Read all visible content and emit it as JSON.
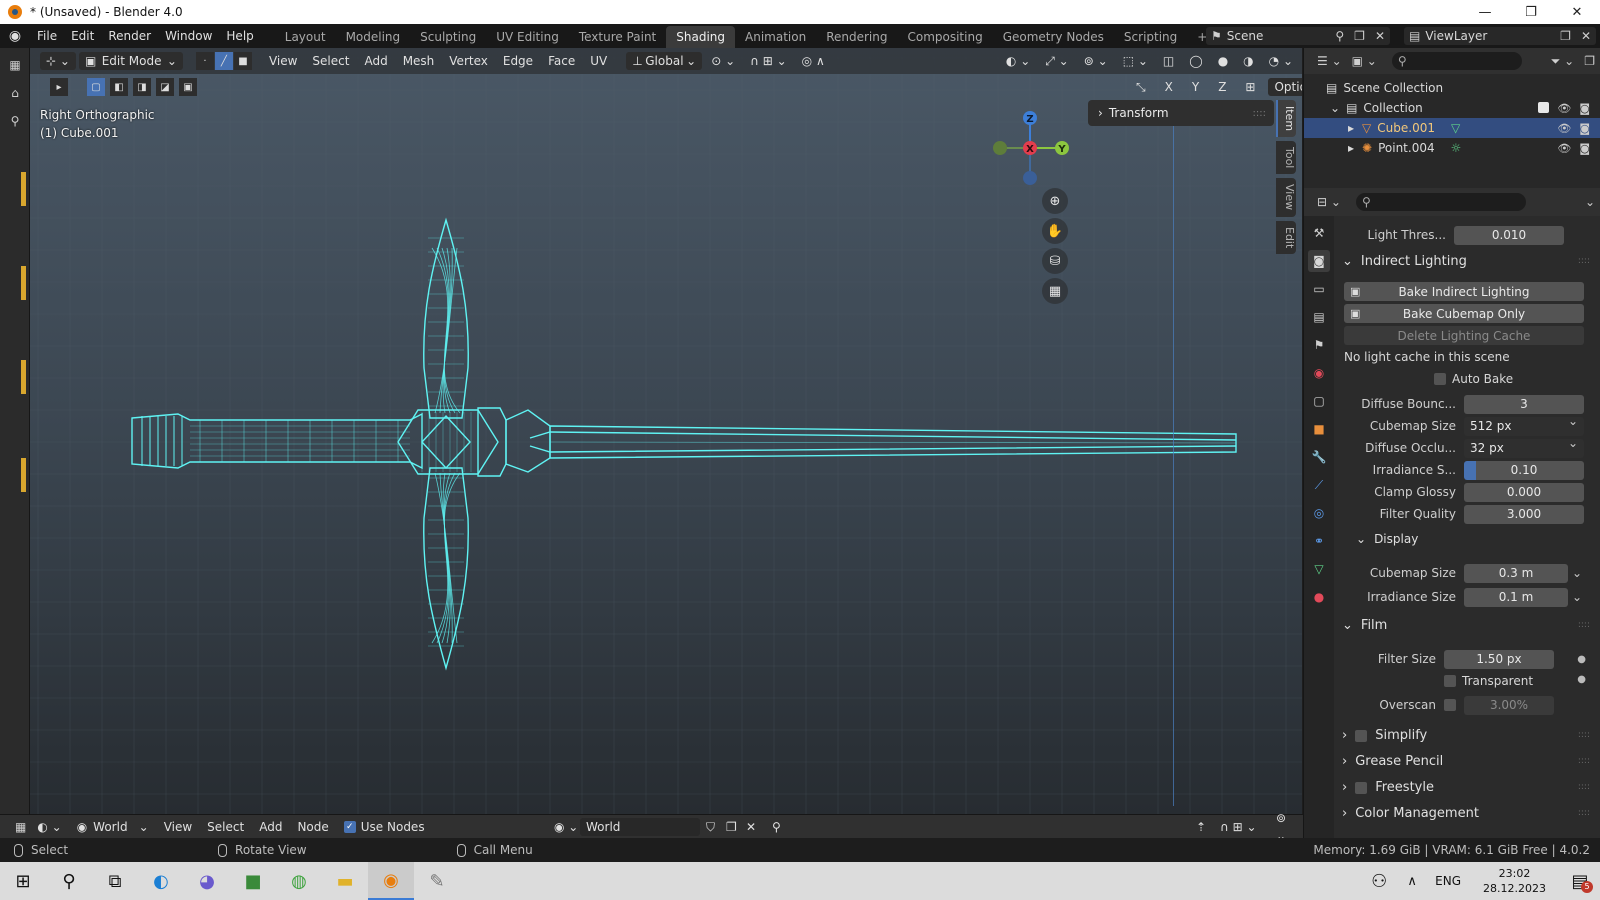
{
  "window": {
    "title": "* (Unsaved) - Blender 4.0",
    "controls": [
      "—",
      "❐",
      "✕"
    ]
  },
  "menus": [
    "File",
    "Edit",
    "Render",
    "Window",
    "Help"
  ],
  "workspace_tabs": [
    {
      "label": "Layout",
      "active": false
    },
    {
      "label": "Modeling",
      "active": false
    },
    {
      "label": "Sculpting",
      "active": false
    },
    {
      "label": "UV Editing",
      "active": false
    },
    {
      "label": "Texture Paint",
      "active": false
    },
    {
      "label": "Shading",
      "active": true
    },
    {
      "label": "Animation",
      "active": false
    },
    {
      "label": "Rendering",
      "active": false
    },
    {
      "label": "Compositing",
      "active": false
    },
    {
      "label": "Geometry Nodes",
      "active": false
    },
    {
      "label": "Scripting",
      "active": false
    }
  ],
  "add_workspace": "+",
  "scene": {
    "label": "Scene"
  },
  "view_layer": {
    "label": "ViewLayer"
  },
  "viewport": {
    "mode": "Edit Mode",
    "menus": [
      "View",
      "Select",
      "Add",
      "Mesh",
      "Vertex",
      "Edge",
      "Face",
      "UV"
    ],
    "transform_orientation": "Global",
    "view_name": "Right Orthographic",
    "object_name": "(1) Cube.001",
    "options_label": "Options",
    "axis_lock": [
      "X",
      "Y",
      "Z"
    ],
    "transform_panel": "Transform",
    "side_tabs": [
      "Item",
      "Tool",
      "View",
      "Edit"
    ],
    "gizmo": {
      "z": "Z",
      "x": "X",
      "y": "Y"
    },
    "colors": {
      "wire": "#5ff3f3",
      "accent": "#4772b3",
      "axis_x": "#e23d4d",
      "axis_y": "#8cc63f",
      "axis_z": "#3d7fd9"
    }
  },
  "outliner": {
    "root": "Scene Collection",
    "collection": "Collection",
    "items": [
      {
        "name": "Cube.001",
        "selected": true
      },
      {
        "name": "Point.004",
        "selected": false
      }
    ]
  },
  "properties": {
    "light_threshold": {
      "label": "Light Thres...",
      "value": "0.010"
    },
    "indirect_lighting": {
      "title": "Indirect Lighting",
      "bake_indirect": "Bake Indirect Lighting",
      "bake_cubemap": "Bake Cubemap Only",
      "delete_cache": "Delete Lighting Cache",
      "info": "No light cache in this scene",
      "auto_bake": "Auto Bake",
      "diffuse_bounces": {
        "label": "Diffuse Bounc...",
        "value": "3"
      },
      "cubemap_size": {
        "label": "Cubemap Size",
        "value": "512 px"
      },
      "diffuse_occlusion": {
        "label": "Diffuse Occlu...",
        "value": "32 px"
      },
      "irradiance_smoothing": {
        "label": "Irradiance S...",
        "value": "0.10",
        "fraction": 0.1
      },
      "clamp_glossy": {
        "label": "Clamp Glossy",
        "value": "0.000"
      },
      "filter_quality": {
        "label": "Filter Quality",
        "value": "3.000"
      }
    },
    "display": {
      "title": "Display",
      "cubemap_size": {
        "label": "Cubemap Size",
        "value": "0.3 m"
      },
      "irradiance_size": {
        "label": "Irradiance Size",
        "value": "0.1 m"
      }
    },
    "film": {
      "title": "Film",
      "filter_size": {
        "label": "Filter Size",
        "value": "1.50 px"
      },
      "transparent": "Transparent",
      "overscan": {
        "label": "Overscan",
        "value": "3.00%"
      }
    },
    "collapsed_panels": [
      "Simplify",
      "Grease Pencil",
      "Freestyle",
      "Color Management"
    ]
  },
  "node_editor": {
    "world_label": "World",
    "menus": [
      "View",
      "Select",
      "Add",
      "Node"
    ],
    "use_nodes": "Use Nodes",
    "world_field": "World"
  },
  "status_bar": {
    "select": "Select",
    "rotate": "Rotate View",
    "call_menu": "Call Menu",
    "memory": "Memory: 1.69 GiB | VRAM: 6.1 GiB Free | 4.0.2"
  },
  "taskbar": {
    "language": "ENG",
    "time": "23:02",
    "date": "28.12.2023",
    "notifications": "5"
  }
}
